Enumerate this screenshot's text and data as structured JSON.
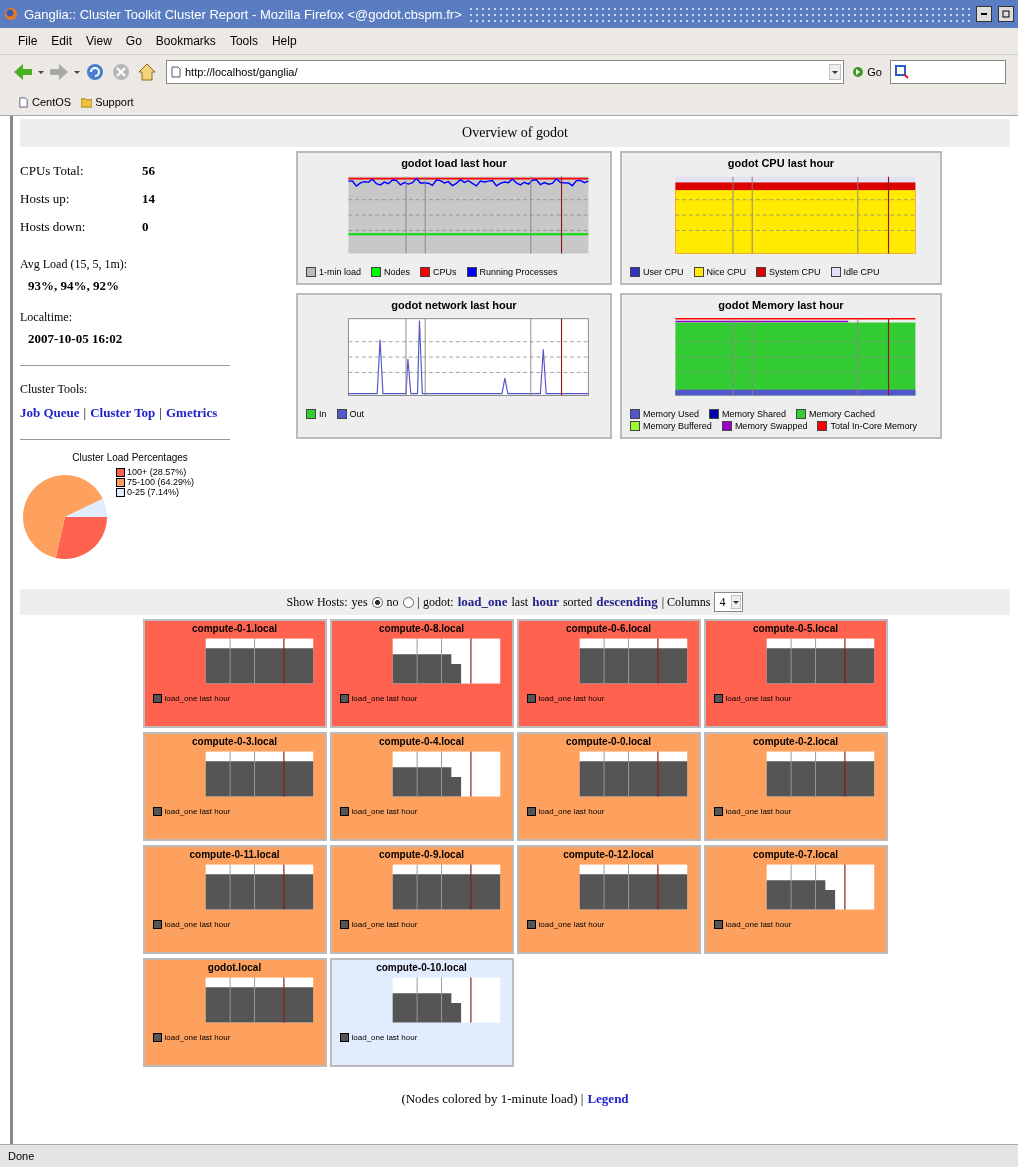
{
  "window": {
    "title": "Ganglia:: Cluster Toolkit Cluster Report - Mozilla Firefox <@godot.cbspm.fr>"
  },
  "menu": [
    "File",
    "Edit",
    "View",
    "Go",
    "Bookmarks",
    "Tools",
    "Help"
  ],
  "toolbar": {
    "url": "http://localhost/ganglia/",
    "go": "Go"
  },
  "bookmarks": [
    "CentOS",
    "Support"
  ],
  "page": {
    "heading": "Overview of godot",
    "stats": [
      {
        "label": "CPUs Total:",
        "value": "56"
      },
      {
        "label": "Hosts up:",
        "value": "14"
      },
      {
        "label": "Hosts down:",
        "value": "0"
      }
    ],
    "avg_load": {
      "label": "Avg Load (15, 5, 1m):",
      "value": "93%, 94%, 92%"
    },
    "localtime": {
      "label": "Localtime:",
      "value": "2007-10-05 16:02"
    },
    "tools": {
      "label": "Cluster Tools:",
      "items": [
        {
          "kind": "link",
          "text": "Job Queue"
        },
        {
          "kind": "separator",
          "text": "|"
        },
        {
          "kind": "link",
          "text": "Cluster Top"
        },
        {
          "kind": "separator",
          "text": "|"
        },
        {
          "kind": "link",
          "text": "Gmetrics"
        }
      ]
    },
    "pie": {
      "chart_data": {
        "type": "pie",
        "title": "Cluster Load Percentages",
        "legend": "right",
        "categories": [
          "100+ (28.57%)",
          "75-100 (64.29%)",
          "0-25 (7.14%)"
        ],
        "values": [
          28.57,
          64.29,
          7.14
        ],
        "colors": [
          "#ff634f",
          "#ffa15e",
          "#e2ecff"
        ]
      }
    },
    "graphs": [
      {
        "kind": "load",
        "title": "godot load last hour",
        "legend": [
          {
            "label": "1-min load",
            "color": "#bbbbbb"
          },
          {
            "label": "Nodes",
            "color": "#00ff00"
          },
          {
            "label": "CPUs",
            "color": "#ff0000"
          },
          {
            "label": "Running Processes",
            "color": "#0000ff"
          }
        ]
      },
      {
        "kind": "cpu",
        "title": "godot CPU last hour",
        "legend": [
          {
            "label": "User CPU",
            "color": "#3333bb"
          },
          {
            "label": "Nice CPU",
            "color": "#ffea00"
          },
          {
            "label": "System CPU",
            "color": "#dd0000"
          },
          {
            "label": "Idle CPU",
            "color": "#e2e2f2"
          }
        ]
      },
      {
        "kind": "network",
        "title": "godot network last hour",
        "legend": [
          {
            "label": "In",
            "color": "#33cc33"
          },
          {
            "label": "Out",
            "color": "#5555cc"
          }
        ]
      },
      {
        "kind": "memory",
        "title": "godot Memory last hour",
        "legend": [
          {
            "label": "Memory Used",
            "color": "#5555cc"
          },
          {
            "label": "Memory Shared",
            "color": "#0000aa"
          },
          {
            "label": "Memory Cached",
            "color": "#33cc33"
          },
          {
            "label": "Memory Buffered",
            "color": "#99ff33"
          },
          {
            "label": "Memory Swapped",
            "color": "#9900cc"
          },
          {
            "label": "Total In-Core Memory",
            "color": "#ff0000"
          }
        ]
      }
    ],
    "sort_bar": {
      "show_hosts": "Show Hosts:",
      "options": [
        {
          "label": "yes",
          "selected": true
        },
        {
          "label": "no",
          "selected": false
        }
      ],
      "cluster": "| godot:",
      "metric": "load_one",
      "range": "last",
      "range_link": "hour",
      "sorted": "sorted",
      "order": "descending",
      "columns_label": "| Columns",
      "columns": "4"
    },
    "nodes": [
      {
        "name": "compute-0-1.local",
        "color": "#ff634f",
        "legend": "load_one last hour",
        "drop": false
      },
      {
        "name": "compute-0-8.local",
        "color": "#ff634f",
        "legend": "load_one last hour",
        "drop": true
      },
      {
        "name": "compute-0-6.local",
        "color": "#ff634f",
        "legend": "load_one last hour",
        "drop": false
      },
      {
        "name": "compute-0-5.local",
        "color": "#ff634f",
        "legend": "load_one last hour",
        "drop": false
      },
      {
        "name": "compute-0-3.local",
        "color": "#ffa15e",
        "legend": "load_one last hour",
        "drop": false
      },
      {
        "name": "compute-0-4.local",
        "color": "#ffa15e",
        "legend": "load_one last hour",
        "drop": true
      },
      {
        "name": "compute-0-0.local",
        "color": "#ffa15e",
        "legend": "load_one last hour",
        "drop": false
      },
      {
        "name": "compute-0-2.local",
        "color": "#ffa15e",
        "legend": "load_one last hour",
        "drop": false
      },
      {
        "name": "compute-0-11.local",
        "color": "#ffa15e",
        "legend": "load_one last hour",
        "drop": false
      },
      {
        "name": "compute-0-9.local",
        "color": "#ffa15e",
        "legend": "load_one last hour",
        "drop": false
      },
      {
        "name": "compute-0-12.local",
        "color": "#ffa15e",
        "legend": "load_one last hour",
        "drop": false
      },
      {
        "name": "compute-0-7.local",
        "color": "#ffa15e",
        "legend": "load_one last hour",
        "drop": true
      },
      {
        "name": "godot.local",
        "color": "#ffa15e",
        "legend": "load_one last hour",
        "drop": false
      },
      {
        "name": "compute-0-10.local",
        "color": "#e2ecff",
        "legend": "load_one last hour",
        "drop": true
      }
    ],
    "footer": {
      "note": "(Nodes colored by 1-minute load) |",
      "link": "Legend"
    }
  },
  "status_bar": "Done"
}
